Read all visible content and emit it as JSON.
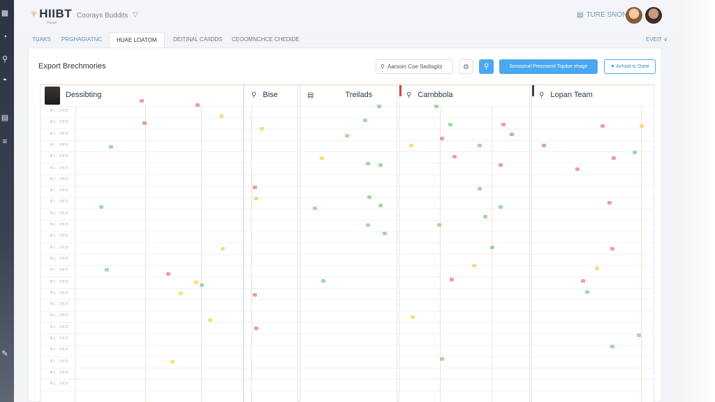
{
  "app": {
    "logo": "HIIBT",
    "logo_sub": "Pacoo",
    "subtitle": "Coorays Buddits",
    "chevron": "▽",
    "team_link": "TURE SNON"
  },
  "tabs": [
    {
      "label": "TUAKS",
      "active": false
    },
    {
      "label": "PRGHAGIATNC",
      "active": false
    },
    {
      "label": "HUAE LOATOM",
      "active": true
    },
    {
      "label": "DEITINAL CAIIDDS",
      "active": false
    },
    {
      "label": "CEOOMNCHCE CHEDIDE",
      "active": false
    }
  ],
  "tabs_right": "EVEIT ∨",
  "panel": {
    "title": "Export Brechmories",
    "search_text": "Aarsoin Coe Sedisgitz",
    "primary_button": "Sorosonal Presnoinsl Tspdoe ehage",
    "outline_button": "Avhaid ts Oane"
  },
  "columns": [
    {
      "title": "Dessibting",
      "icon": "avatar-thumb"
    },
    {
      "title": "Bise",
      "icon": "search-icon"
    },
    {
      "title": "Treilads",
      "icon": "list-icon"
    },
    {
      "title": "Cambbola",
      "icon": "search-icon"
    },
    {
      "title": "Lopan Team",
      "icon": "search-icon"
    }
  ],
  "row_labels": [
    "RL. 2KO",
    "RL. 2KO",
    "RL. 2KO",
    "RL. 2KO",
    "RL. 2KO",
    "RL. 2KO",
    "RL. 2KO",
    "RL. 2KO",
    "RL. 2KO",
    "RL. 2KO",
    "RL. 2KO",
    "RL. 2KO",
    "RL. 2KO",
    "RL. 2KO",
    "RL. 2KO",
    "RL. 2KO",
    "RL. 2KO",
    "RL. 2KO",
    "RL. 2KO",
    "RL. 2KO",
    "RL. 2KO",
    "RL. 2KO",
    "RL. 2KO",
    "RL. 2KO",
    "RL. 2KO"
  ],
  "colors": {
    "accent": "#4aa8f0",
    "rail": "#2b3442",
    "dot_red": "#d9534f",
    "dot_green": "#5cb85c",
    "dot_yellow": "#f0c419"
  }
}
